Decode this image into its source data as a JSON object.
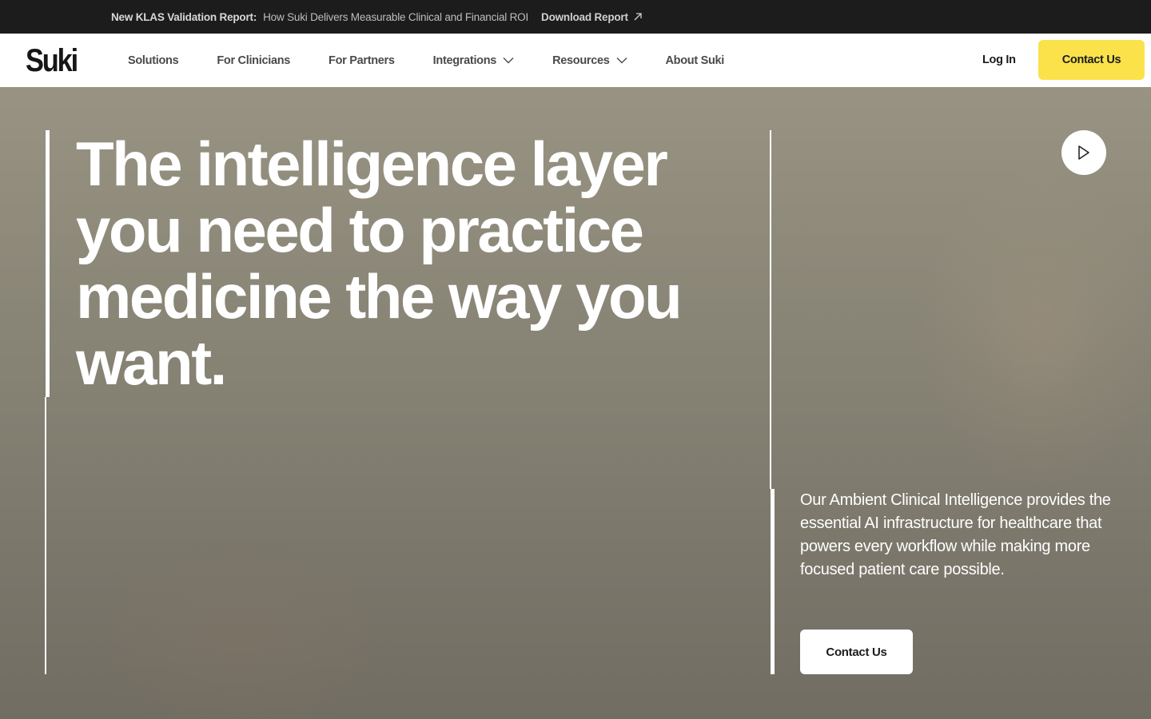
{
  "announcement": {
    "lead": "New KLAS Validation Report:",
    "text": "How Suki Delivers Measurable Clinical and Financial ROI",
    "link_label": "Download Report",
    "link_icon": "arrow-up-right-icon"
  },
  "nav": {
    "logo": "Suki",
    "items": [
      {
        "label": "Solutions",
        "has_dropdown": false
      },
      {
        "label": "For Clinicians",
        "has_dropdown": false
      },
      {
        "label": "For Partners",
        "has_dropdown": false
      },
      {
        "label": "Integrations",
        "has_dropdown": true
      },
      {
        "label": "Resources",
        "has_dropdown": true
      },
      {
        "label": "About Suki",
        "has_dropdown": false
      }
    ],
    "login_label": "Log In",
    "contact_label": "Contact Us",
    "contact_color": "#fbe24a"
  },
  "hero": {
    "headline": "The intelligence layer you need to practice medicine the way you want.",
    "play_icon": "play-icon",
    "description": "Our Ambient Clinical Intelligence provides the essential AI infrastructure for healthcare that powers every workflow while making more focused patient care possible.",
    "contact_label": "Contact Us"
  }
}
